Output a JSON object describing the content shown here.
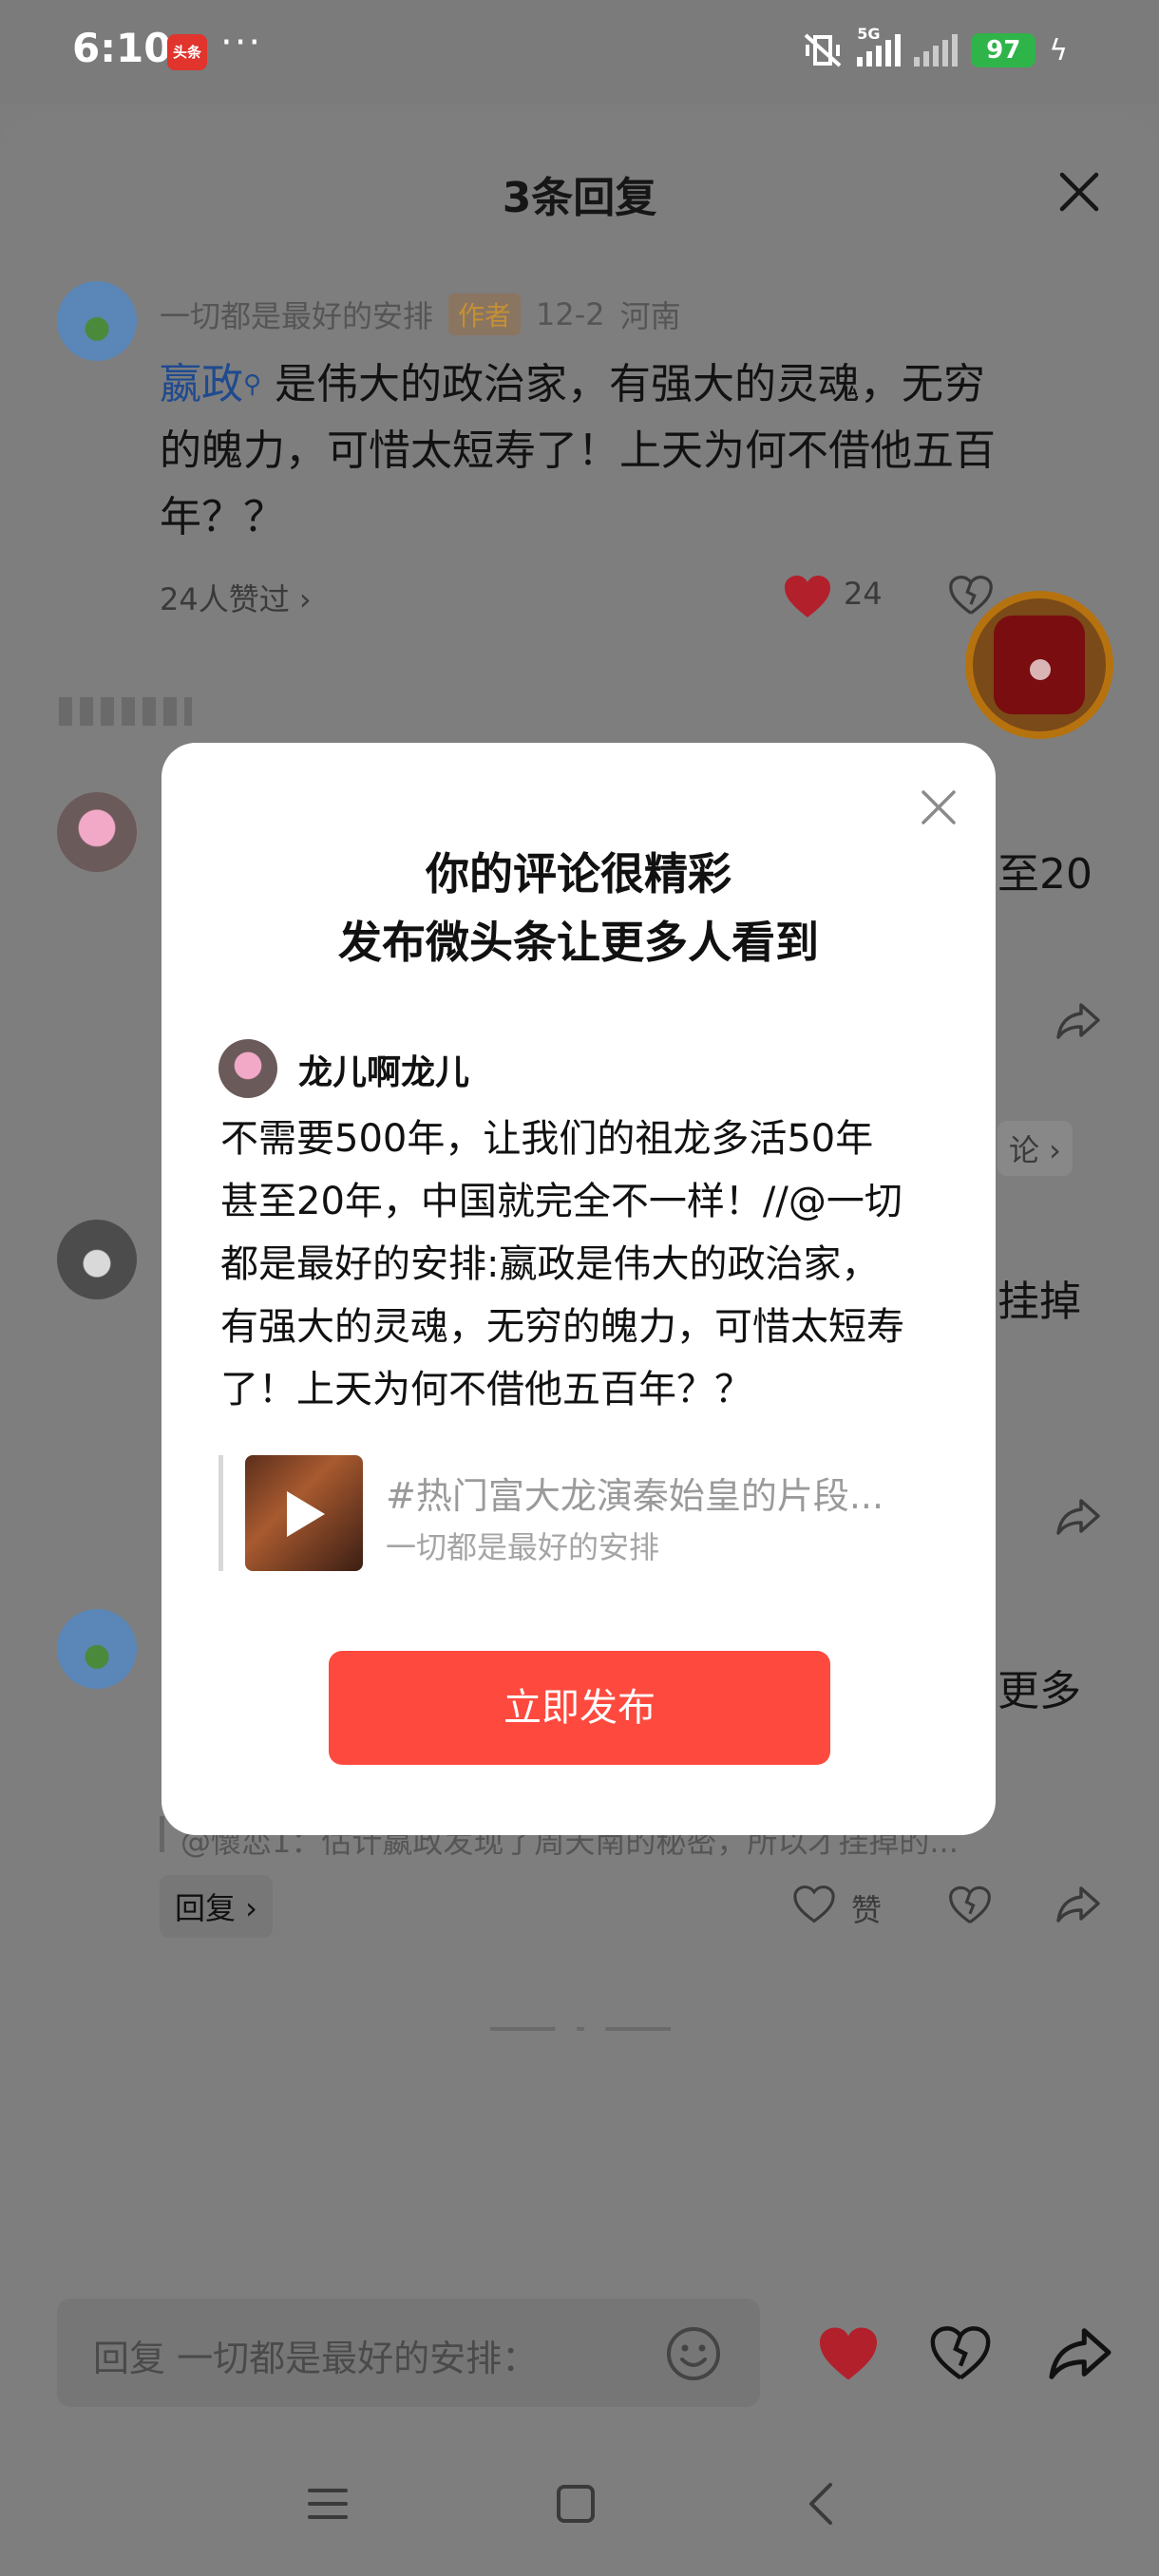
{
  "status": {
    "time": "6:10",
    "app_badge": "头条",
    "more": "···",
    "network": "5G",
    "battery": "97"
  },
  "sheet": {
    "title": "3条回复"
  },
  "main_comment": {
    "author": "一切都是最好的安排",
    "author_tag": "作者",
    "date": "12-2",
    "location": "河南",
    "link_text": "嬴政",
    "text_line1": "是伟大的政治家，有强大的灵魂，无穷",
    "text_line2": "的魄力，可惜太短寿了！上天为何不借他五百",
    "text_line3": "年？？",
    "liked_by": "24人赞过 ›",
    "like_count": "24"
  },
  "reply1": {
    "partial_text": "至20",
    "reply_more": "论 ›"
  },
  "reply2": {
    "partial_text": "挂掉"
  },
  "reply3": {
    "partial_text": "更多",
    "quote_line": "@懷恋1：估计嬴政发现了周天南的秘密，所以才挂掉的...",
    "reply_button": "回复 ›",
    "like_label": "赞"
  },
  "modal": {
    "title_line1": "你的评论很精彩",
    "title_line2": "发布微头条让更多人看到",
    "username": "龙儿啊龙儿",
    "body_line1": "不需要500年，让我们的祖龙多活50年",
    "body_line2": "甚至20年，中国就完全不一样！//@一切",
    "body_line3": "都是最好的安排:嬴政是伟大的政治家，",
    "body_line4": "有强大的灵魂，无穷的魄力，可惜太短寿",
    "body_line5": "了！上天为何不借他五百年？？",
    "quote_title": "#热门富大龙演秦始皇的片段...",
    "quote_author": "一切都是最好的安排",
    "publish_button": "立即发布"
  },
  "bottom_bar": {
    "reply_placeholder": "回复 一切都是最好的安排："
  },
  "colors": {
    "accent_red": "#fe4a3e",
    "link_blue": "#1f4a8f",
    "heart_red": "#b2202b"
  },
  "icons": [
    "close-icon",
    "heart-icon",
    "broken-heart-icon",
    "share-icon",
    "emoji-icon",
    "menu-icon",
    "home-icon",
    "back-icon",
    "play-icon",
    "red-packet-icon"
  ]
}
